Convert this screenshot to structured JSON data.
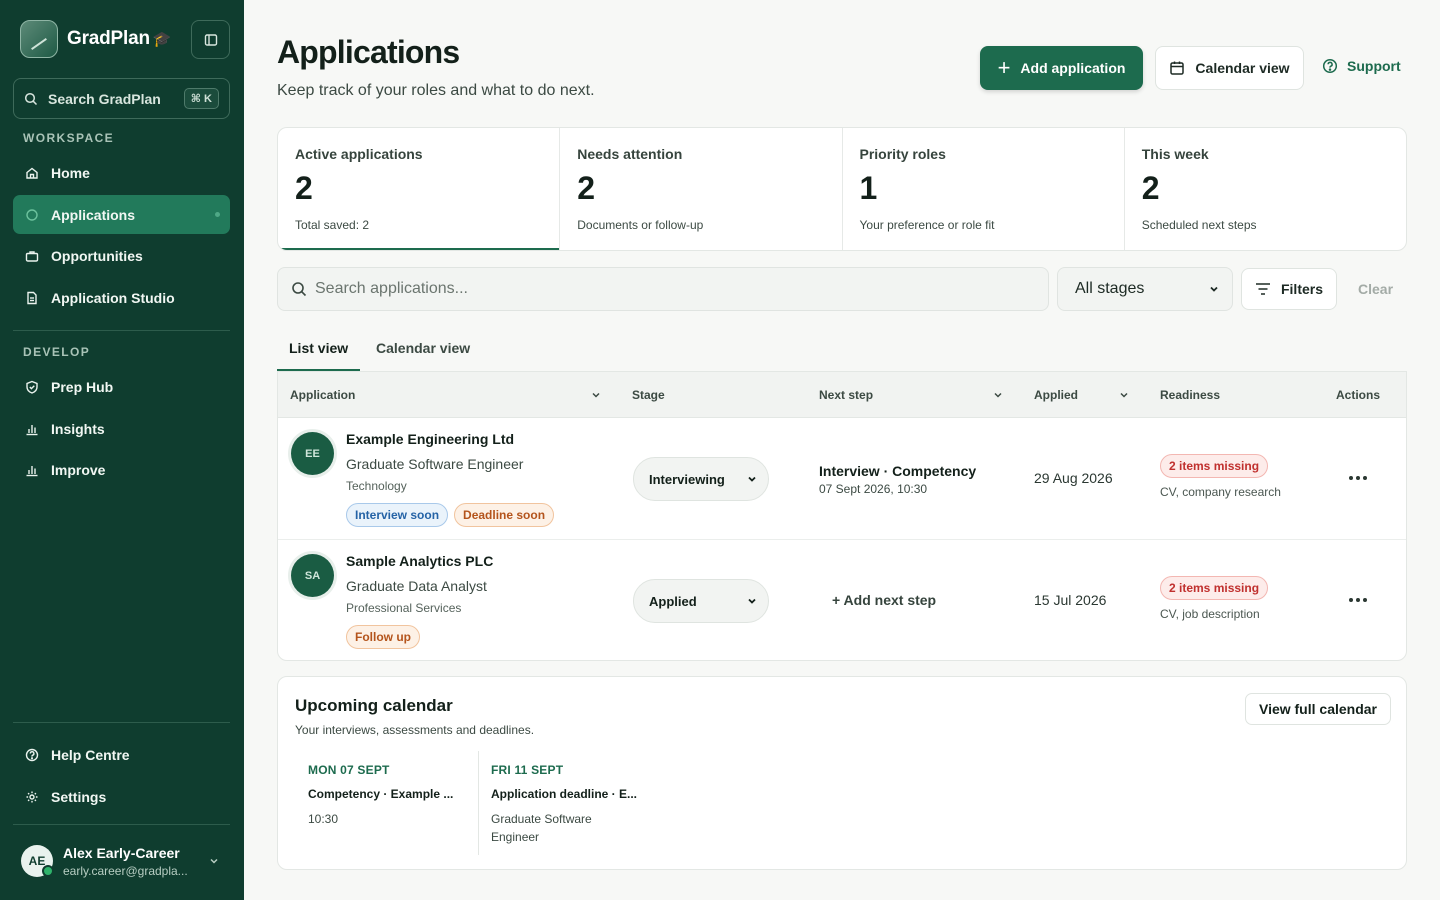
{
  "app": {
    "name": "GradPlan"
  },
  "sidebar": {
    "search_label": "Search GradPlan",
    "search_shortcut": "⌘ K",
    "workspace_label": "WORKSPACE",
    "workspace_items": [
      {
        "label": "Home",
        "icon": "home-icon"
      },
      {
        "label": "Applications",
        "icon": "applications-icon",
        "active": true
      },
      {
        "label": "Opportunities",
        "icon": "briefcase-icon"
      },
      {
        "label": "Application Studio",
        "icon": "document-icon"
      }
    ],
    "develop_label": "DEVELOP",
    "develop_items": [
      {
        "label": "Prep Hub",
        "icon": "shield-check-icon"
      },
      {
        "label": "Insights",
        "icon": "bar-chart-icon"
      },
      {
        "label": "Improve",
        "icon": "bar-chart-icon"
      }
    ],
    "bottom_items": [
      {
        "label": "Help Centre",
        "icon": "help-circle-icon"
      },
      {
        "label": "Settings",
        "icon": "gear-icon"
      }
    ],
    "user": {
      "initials": "AE",
      "name": "Alex Early-Career",
      "email": "early.career@gradpla..."
    }
  },
  "header": {
    "title": "Applications",
    "subtitle": "Keep track of your roles and what to do next.",
    "add_button": "Add application",
    "calendar_button": "Calendar view",
    "support_link": "Support"
  },
  "stats": [
    {
      "label": "Active applications",
      "value": "2",
      "note": "Total saved: 2"
    },
    {
      "label": "Needs attention",
      "value": "2",
      "note": "Documents or follow-up"
    },
    {
      "label": "Priority roles",
      "value": "1",
      "note": "Your preference or role fit"
    },
    {
      "label": "This week",
      "value": "2",
      "note": "Scheduled next steps"
    }
  ],
  "toolbar": {
    "search_placeholder": "Search applications...",
    "stage_filter": "All stages",
    "filters_button": "Filters",
    "clear_button": "Clear"
  },
  "tabs": {
    "list": "List view",
    "calendar": "Calendar view"
  },
  "table": {
    "columns": {
      "application": "Application",
      "stage": "Stage",
      "next_step": "Next step",
      "applied": "Applied",
      "readiness": "Readiness",
      "actions": "Actions"
    },
    "rows": [
      {
        "initials": "EE",
        "company": "Example Engineering Ltd",
        "role": "Graduate Software Engineer",
        "sector": "Technology",
        "tags": [
          "Interview soon",
          "Deadline soon"
        ],
        "stage": "Interviewing",
        "next_step_title": "Interview · Competency",
        "next_step_time": "07 Sept 2026, 10:30",
        "applied": "29 Aug 2026",
        "readiness_badge": "2 items missing",
        "readiness_note": "CV, company research"
      },
      {
        "initials": "SA",
        "company": "Sample Analytics PLC",
        "role": "Graduate Data Analyst",
        "sector": "Professional Services",
        "tags": [
          "Follow up"
        ],
        "stage": "Applied",
        "next_step_add": "+ Add next step",
        "applied": "15 Jul 2026",
        "readiness_badge": "2 items missing",
        "readiness_note": "CV, job description"
      }
    ]
  },
  "calendar": {
    "title": "Upcoming calendar",
    "subtitle": "Your interviews, assessments and deadlines.",
    "view_button": "View full calendar",
    "events": [
      {
        "date": "MON 07 SEPT",
        "title": "Competency · Example ...",
        "meta": "10:30"
      },
      {
        "date": "FRI 11 SEPT",
        "title": "Application deadline · E...",
        "meta": "Graduate Software Engineer"
      }
    ]
  },
  "colors": {
    "sidebar": "#0f3d2f",
    "accent": "#1d6b4e",
    "active_nav": "#227a5b",
    "warning": "#c0302e"
  }
}
